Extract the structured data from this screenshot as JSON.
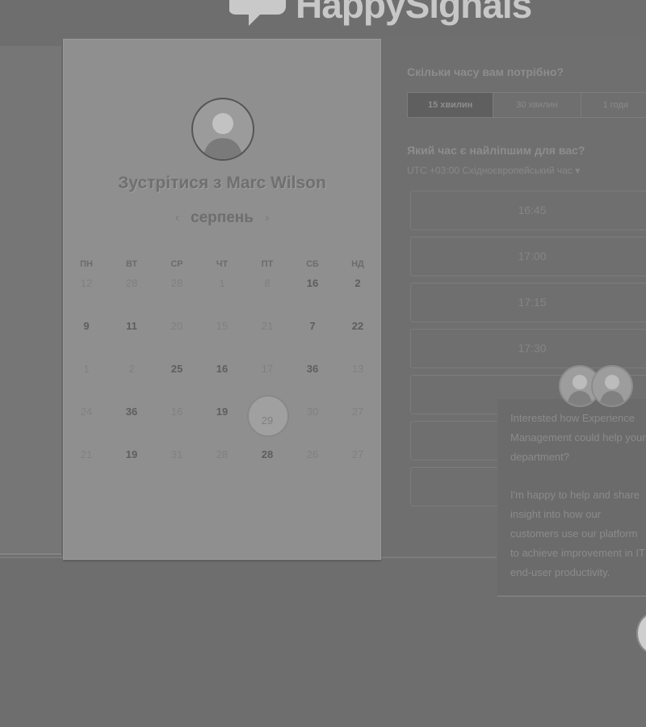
{
  "brand": {
    "name": "HappySignals"
  },
  "calendar": {
    "title": "Зустрітися з Marc Wilson",
    "month": "серпень",
    "prev_icon": "chevron-left-icon",
    "next_icon": "chevron-right-icon",
    "weekdays": [
      "ПН",
      "ВТ",
      "СР",
      "ЧТ",
      "ПТ",
      "СБ",
      "НД"
    ],
    "weeks": [
      [
        {
          "d": "12"
        },
        {
          "d": "28"
        },
        {
          "d": "28"
        },
        {
          "d": "1"
        },
        {
          "d": "8"
        },
        {
          "d": "16",
          "b": true
        },
        {
          "d": "2",
          "b": true
        }
      ],
      [
        {
          "d": "9",
          "b": true
        },
        {
          "d": "11",
          "b": true
        },
        {
          "d": "20"
        },
        {
          "d": "15"
        },
        {
          "d": "21"
        },
        {
          "d": "7",
          "b": true
        },
        {
          "d": "22",
          "b": true
        }
      ],
      [
        {
          "d": "1"
        },
        {
          "d": "2"
        },
        {
          "d": "25",
          "b": true
        },
        {
          "d": "16",
          "b": true
        },
        {
          "d": "17"
        },
        {
          "d": "36",
          "b": true
        },
        {
          "d": "13"
        }
      ],
      [
        {
          "d": "24"
        },
        {
          "d": "36",
          "b": true
        },
        {
          "d": "16"
        },
        {
          "d": "19",
          "b": true
        },
        {
          "d": "29",
          "sel": true
        },
        {
          "d": "30"
        },
        {
          "d": "27"
        }
      ],
      [
        {
          "d": "21"
        },
        {
          "d": "19",
          "b": true
        },
        {
          "d": "31"
        },
        {
          "d": "28"
        },
        {
          "d": "28",
          "b": true
        },
        {
          "d": "26"
        },
        {
          "d": "27"
        }
      ]
    ]
  },
  "booking": {
    "duration_question": "Скільки часу вам потрібно?",
    "durations": [
      "15 хвилин",
      "30 хвилин",
      "1 годи"
    ],
    "selected_duration": "15 хвилин",
    "time_question": "Який час є найліпшим для вас?",
    "timezone": "UTC +03:00 Східноєвропейський час",
    "timezone_icon": "caret-down-icon",
    "slots": [
      "16:45",
      "17:00",
      "17:15",
      "17:30",
      "",
      "",
      ""
    ]
  },
  "chat": {
    "paragraph1": "Interested how Experience Management could help your department?",
    "paragraph2": "I'm happy to help and share insight into how our customers use our platform to achieve improvement in IT end-user productivity."
  },
  "colors": {
    "background": "#6e6e6e",
    "card": "#8f8f8f",
    "active_tab": "#5f5f5f"
  }
}
